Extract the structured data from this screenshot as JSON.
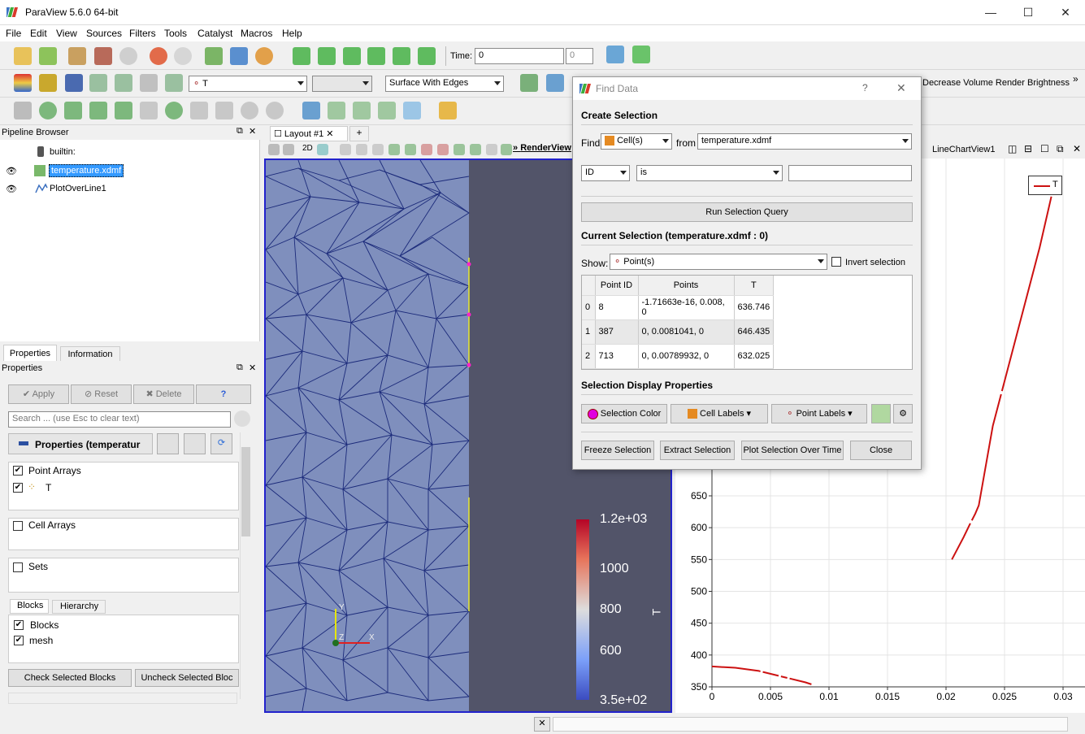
{
  "app": {
    "title": "ParaView 5.6.0 64-bit",
    "win_min": "—",
    "win_max": "☐",
    "win_close": "✕"
  },
  "menu": [
    "File",
    "Edit",
    "View",
    "Sources",
    "Filters",
    "Tools",
    "Catalyst",
    "Macros",
    "Help"
  ],
  "toolbar": {
    "time_label": "Time:",
    "time_value": "0",
    "time_index": "0",
    "array_combo": "T",
    "repr_combo": "Surface With Edges",
    "decrease_volume": "Decrease Volume Render Brightness"
  },
  "pipeline": {
    "title": "Pipeline Browser",
    "items": [
      "builtin:",
      "temperature.xdmf",
      "PlotOverLine1"
    ]
  },
  "props": {
    "tabs": [
      "Properties",
      "Information"
    ],
    "title": "Properties",
    "apply": "Apply",
    "reset": "Reset",
    "delete": "Delete",
    "help": "?",
    "search_placeholder": "Search ... (use Esc to clear text)",
    "section": "Properties (temperatur",
    "point_arrays": "Point Arrays",
    "point_array_T": "T",
    "cell_arrays": "Cell Arrays",
    "sets": "Sets",
    "block_tabs": [
      "Blocks",
      "Hierarchy"
    ],
    "blocks": "Blocks",
    "mesh": "mesh",
    "check_selected": "Check Selected Blocks",
    "uncheck_selected": "Uncheck Selected Bloc"
  },
  "layout": {
    "tab": "Layout #1",
    "add": "+",
    "view_2d": "2D",
    "render_view": "RenderView",
    "chart_view": "LineChartView1"
  },
  "colorbar": {
    "labels": [
      "1.2e+03",
      "1000",
      "800",
      "600",
      "3.5e+02"
    ],
    "title": "T"
  },
  "axes": {
    "y": "Y",
    "z": "Z",
    "x": "X"
  },
  "chart_data": {
    "type": "line",
    "series": [
      {
        "name": "T",
        "color": "#cc1111"
      }
    ],
    "x_ticks": [
      "0",
      "0.005",
      "0.01",
      "0.015",
      "0.02",
      "0.025",
      "0.03"
    ],
    "y_ticks": [
      "350",
      "400",
      "450",
      "500",
      "550",
      "600",
      "650"
    ],
    "legend": "top-right",
    "x": [
      0,
      0.002,
      0.004,
      0.006,
      0.008,
      0.0085,
      0.0205,
      0.0215,
      0.022,
      0.0225,
      0.0228,
      0.024,
      0.026,
      0.028,
      0.029
    ],
    "y": [
      382,
      380,
      375,
      366,
      357,
      354,
      550,
      585,
      604,
      622,
      635,
      760,
      900,
      1040,
      1120
    ]
  },
  "dialog": {
    "title": "Find Data",
    "help": "?",
    "close_x": "✕",
    "create_selection": "Create Selection",
    "find_label": "Find",
    "find_type": "Cell(s)",
    "from_label": "from",
    "from_source": "temperature.xdmf",
    "field": "ID",
    "op": "is",
    "query_value": "",
    "run_query": "Run Selection Query",
    "current_selection": "Current Selection (temperature.xdmf : 0)",
    "show_label": "Show:",
    "show_type": "Point(s)",
    "invert": "Invert selection",
    "table": {
      "headers": [
        "Point ID",
        "Points",
        "T"
      ],
      "rows": [
        [
          "0",
          "8",
          "-1.71663e-16, 0.008, 0",
          "636.746"
        ],
        [
          "1",
          "387",
          "0, 0.0081041, 0",
          "646.435"
        ],
        [
          "2",
          "713",
          "0, 0.00789932, 0",
          "632.025"
        ]
      ]
    },
    "display_props": "Selection Display Properties",
    "selection_color": "Selection Color",
    "cell_labels": "Cell Labels",
    "point_labels": "Point Labels",
    "freeze": "Freeze Selection",
    "extract": "Extract Selection",
    "plot_over_time": "Plot Selection Over Time",
    "close": "Close"
  }
}
